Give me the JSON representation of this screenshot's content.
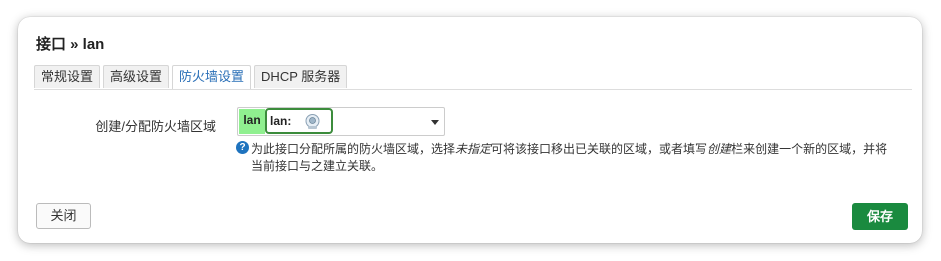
{
  "dialog": {
    "title": "接口 » lan"
  },
  "tabs": [
    {
      "label": "常规设置",
      "active": false
    },
    {
      "label": "高级设置",
      "active": false
    },
    {
      "label": "防火墙设置",
      "active": true
    },
    {
      "label": "DHCP 服务器",
      "active": false
    }
  ],
  "firewall": {
    "field_label": "创建/分配防火墙区域",
    "selected_zone": {
      "tag": "lan",
      "label": "lan:",
      "icon": "network-interface-icon",
      "tag_color": "#90f090"
    },
    "help": {
      "icon": "question-icon",
      "part1": "为此接口分配所属的防火墙区域，选择",
      "em1": "未指定",
      "part2": "可将该接口移出已关联的区域，或者填写",
      "em2": "创建",
      "part3": "栏来创建一个新的区域，并将当前接口与之建立关联。"
    }
  },
  "footer": {
    "close_label": "关闭",
    "save_label": "保存"
  },
  "colors": {
    "active_tab_text": "#2a6fb7",
    "save_button": "#1a8a3f",
    "zone_chip_border": "#3c8c3c"
  }
}
